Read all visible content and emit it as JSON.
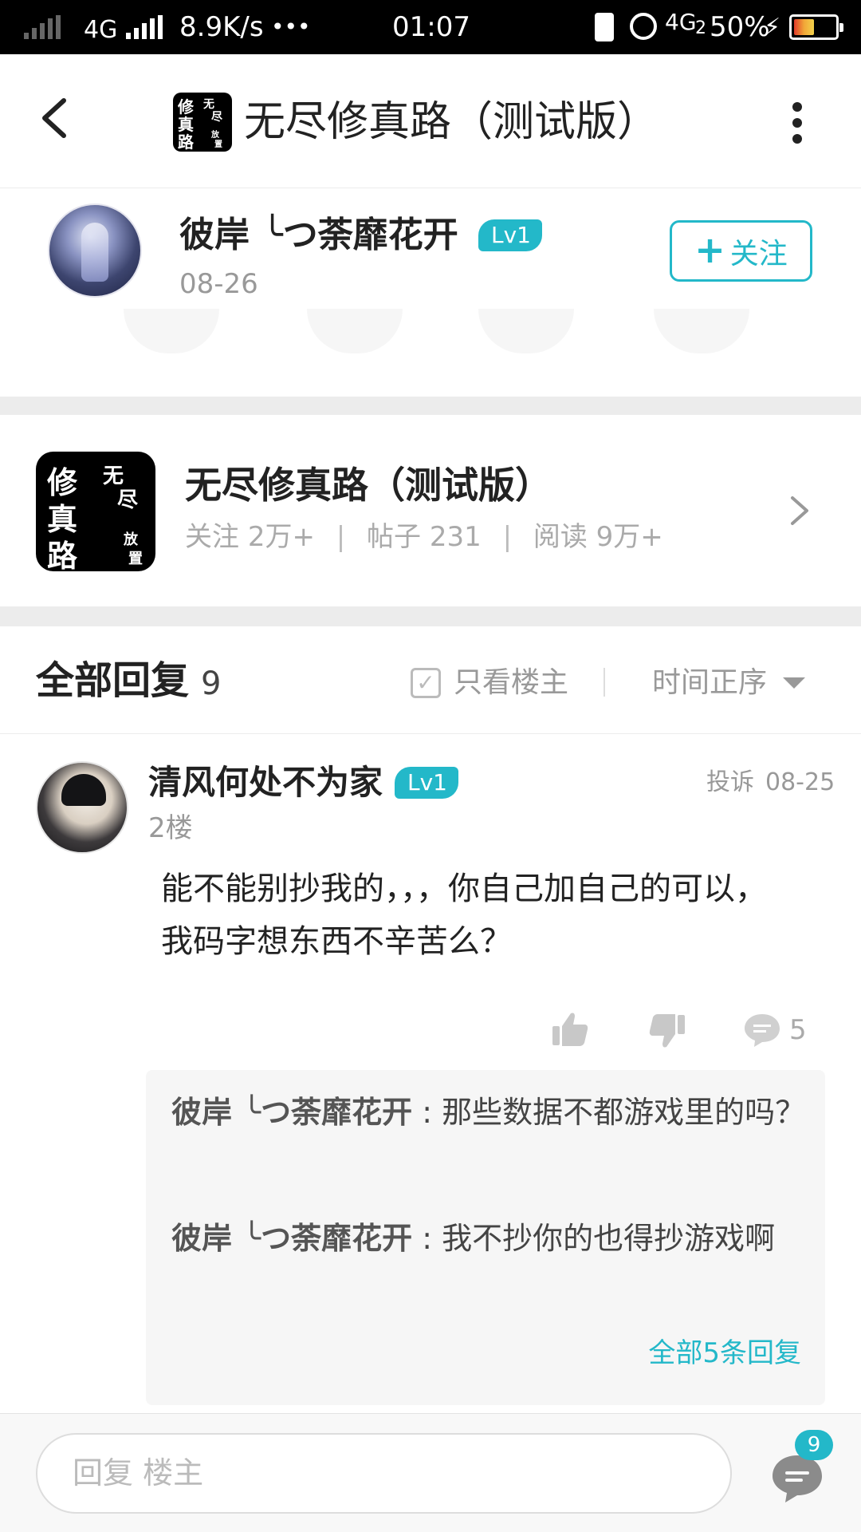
{
  "status_bar": {
    "network_left": "4G",
    "speed": "8.9K/s",
    "dots": "•••",
    "time": "01:07",
    "network_right": "4G",
    "sim_index": "2",
    "battery": "50%",
    "battery_level": 0.5
  },
  "header": {
    "title": "无尽修真路（测试版）",
    "logo_text": [
      "修",
      "真",
      "路",
      "无",
      "尽",
      "放",
      "置"
    ]
  },
  "post": {
    "author_name": "彼岸 ╰つ荼靡花开",
    "author_level": "Lv1",
    "date": "08-26",
    "follow_label": "关注",
    "follow_icon": "+"
  },
  "forum": {
    "name": "无尽修真路（测试版）",
    "stats": [
      {
        "label": "关注",
        "value": "2万+"
      },
      {
        "label": "帖子",
        "value": "231"
      },
      {
        "label": "阅读",
        "value": "9万+"
      }
    ],
    "separator": "|",
    "logo_text": [
      "修",
      "真",
      "路",
      "无",
      "尽",
      "放",
      "置"
    ]
  },
  "replies": {
    "title": "全部回复",
    "count": "9",
    "only_owner_label": "只看楼主",
    "sort_label": "时间正序",
    "items": [
      {
        "author": "清风何处不为家",
        "level": "Lv1",
        "report_label": "投诉",
        "date": "08-25",
        "floor": "2楼",
        "content": "能不能别抄我的，，，你自己加自己的可以，我码字想东西不辛苦么？",
        "like_icon": "thumbs-up-icon",
        "dislike_icon": "thumbs-down-icon",
        "comment_count": "5",
        "sub_replies": [
          {
            "author": "彼岸 ╰つ荼靡花开",
            "separator": ":",
            "text": "那些数据不都游戏里的吗？"
          },
          {
            "author": "彼岸 ╰つ荼靡花开",
            "separator": ":",
            "text": "我不抄你的也得抄游戏啊"
          }
        ],
        "more_label": "全部5条回复"
      }
    ]
  },
  "bottom_bar": {
    "placeholder": "回复  楼主",
    "message_badge": "9"
  },
  "colors": {
    "accent": "#23b8c9",
    "text": "#222222",
    "muted": "#999999",
    "divider": "#ececec"
  }
}
